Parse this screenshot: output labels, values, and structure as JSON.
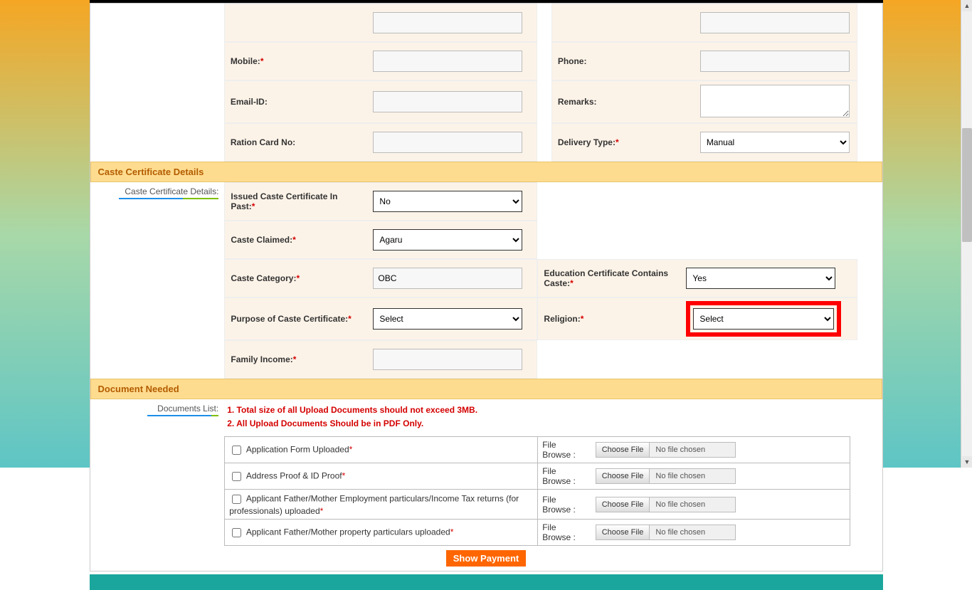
{
  "applicant": {
    "mobile_label": "Mobile:",
    "phone_label": "Phone:",
    "email_label": "Email-ID:",
    "remarks_label": "Remarks:",
    "ration_label": "Ration Card No:",
    "delivery_label": "Delivery Type:",
    "delivery_value": "Manual"
  },
  "section_caste": {
    "title": "Caste Certificate Details",
    "sublabel": "Caste Certificate Details:",
    "issued_label": "Issued Caste Certificate In Past:",
    "issued_value": "No",
    "claimed_label": "Caste Claimed:",
    "claimed_value": "Agaru",
    "category_label": "Caste Category:",
    "category_value": "OBC",
    "edu_label": "Education Certificate Contains Caste:",
    "edu_value": "Yes",
    "purpose_label": "Purpose of Caste Certificate:",
    "purpose_value": "Select",
    "religion_label": "Religion:",
    "religion_value": "Select",
    "income_label": "Family Income:"
  },
  "section_doc": {
    "title": "Document Needed",
    "sublabel": "Documents List:",
    "note1": "1. Total size of all Upload Documents should not exceed 3MB.",
    "note2": "2. All Upload Documents Should be in PDF Only.",
    "browse_label": "File Browse :",
    "choose_btn": "Choose File",
    "no_file": "No file chosen",
    "rows": [
      {
        "label": "Application Form Uploaded"
      },
      {
        "label": "Address Proof & ID Proof"
      },
      {
        "label": "Applicant Father/Mother Employment particulars/Income Tax returns (for professionals) uploaded"
      },
      {
        "label": "Applicant Father/Mother property particulars uploaded"
      }
    ]
  },
  "actions": {
    "show_payment": "Show Payment"
  }
}
